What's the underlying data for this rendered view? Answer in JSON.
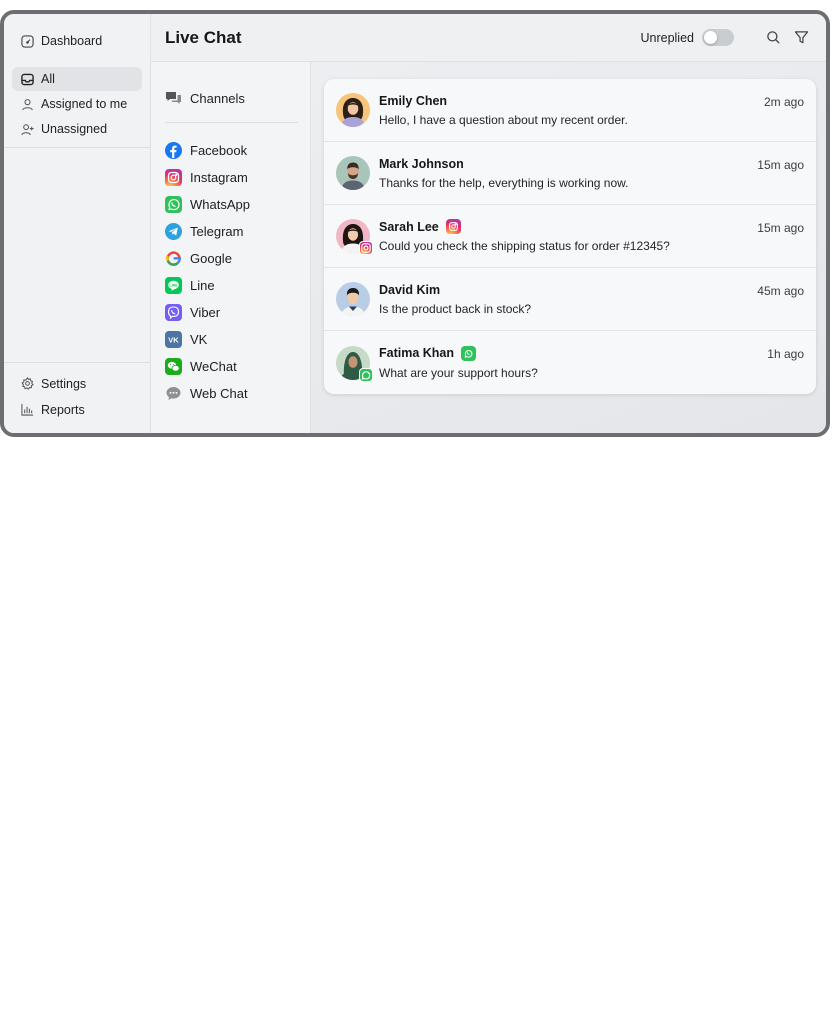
{
  "sidebar": {
    "dashboard_label": "Dashboard",
    "items": [
      {
        "label": "All",
        "icon": "inbox-icon",
        "active": true
      },
      {
        "label": "Assigned to me",
        "icon": "user-icon",
        "active": false
      },
      {
        "label": "Unassigned",
        "icon": "user-plus-icon",
        "active": false
      }
    ],
    "bottom": [
      {
        "label": "Settings",
        "icon": "gear-icon"
      },
      {
        "label": "Reports",
        "icon": "bar-chart-icon"
      }
    ]
  },
  "header": {
    "title": "Live Chat",
    "unreplied_label": "Unreplied",
    "unreplied_on": false
  },
  "channels": {
    "heading": "Channels",
    "items": [
      {
        "label": "Facebook",
        "color": "#1877f2"
      },
      {
        "label": "Instagram",
        "color": "#e1306c"
      },
      {
        "label": "WhatsApp",
        "color": "#25d366"
      },
      {
        "label": "Telegram",
        "color": "#2aa3df"
      },
      {
        "label": "Google",
        "color": "#4285f4"
      },
      {
        "label": "Line",
        "color": "#06c755"
      },
      {
        "label": "Viber",
        "color": "#7360f2"
      },
      {
        "label": "VK",
        "color": "#4c75a3"
      },
      {
        "label": "WeChat",
        "color": "#1aad19"
      },
      {
        "label": "Web Chat",
        "color": "#8e9096"
      }
    ]
  },
  "conversations": [
    {
      "name": "Emily Chen",
      "message": "Hello, I have a question about my recent order.",
      "time": "2m ago",
      "channel_badge": ""
    },
    {
      "name": "Mark Johnson",
      "message": "Thanks for the help, everything is working now.",
      "time": "15m ago",
      "channel_badge": ""
    },
    {
      "name": "Sarah Lee",
      "message": "Could you check the shipping status for order #12345?",
      "time": "15m ago",
      "channel_badge": "instagram"
    },
    {
      "name": "David Kim",
      "message": "Is the product back in stock?",
      "time": "45m ago",
      "channel_badge": ""
    },
    {
      "name": "Fatima Khan",
      "message": "What are your support hours?",
      "time": "1h ago",
      "channel_badge": "whatsapp"
    }
  ]
}
